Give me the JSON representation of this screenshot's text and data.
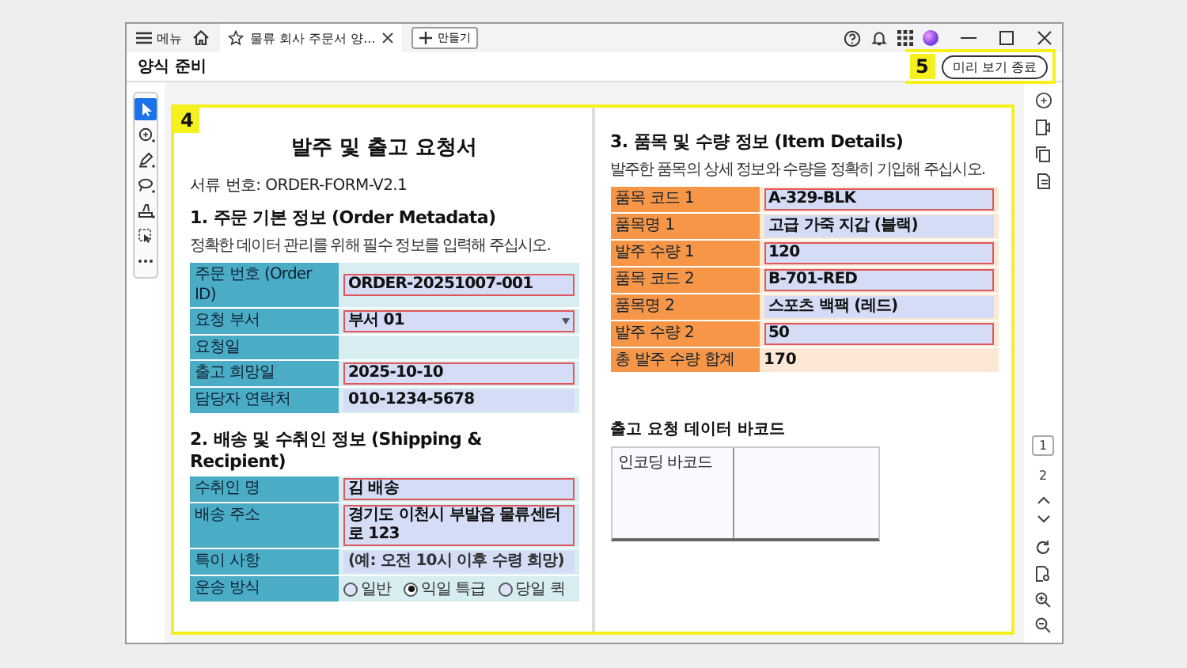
{
  "tabbar": {
    "menu": "메뉴",
    "tab": {
      "title": "물류 회사 주문서 양...",
      "selected": true
    },
    "new_tab": "만들기"
  },
  "toolbar_title": "양식 준비",
  "exit_preview": {
    "label": "미리 보기 종료",
    "annotation": "5"
  },
  "tools": [
    {
      "kind": "pointer",
      "selected": true
    },
    {
      "kind": "comment",
      "selected": false
    },
    {
      "kind": "pen",
      "selected": false
    },
    {
      "kind": "lasso",
      "selected": false
    },
    {
      "kind": "stamp",
      "selected": false
    },
    {
      "kind": "select",
      "selected": false
    },
    {
      "kind": "more",
      "selected": false
    }
  ],
  "document": {
    "annotation": "4",
    "pages": [
      {
        "title": "발주 및 출고 요청서",
        "doc_number": "서류 번호: ORDER-FORM-V2.1",
        "sections": [
          {
            "kind": "form",
            "heading": "1. 주문 기본 정보 (Order Metadata)",
            "description": "정확한 데이터 관리를 위해 필수 정보를 입력해 주십시오.",
            "color": "#4bacc6",
            "rows": [
              {
                "label": "주문 번호 (Order ID)",
                "kind": "input",
                "value": "ORDER-20251007-001",
                "required": true
              },
              {
                "label": "요청 부서",
                "kind": "select",
                "value": "부서 01",
                "required": true
              },
              {
                "label": "요청일",
                "kind": "blank"
              },
              {
                "label": "출고 희망일",
                "kind": "input",
                "value": "2025-10-10",
                "required": true
              },
              {
                "label": "담당자 연락처",
                "kind": "input",
                "value": "010-1234-5678",
                "required": false
              }
            ]
          },
          {
            "kind": "form",
            "heading": "2. 배송 및 수취인 정보 (Shipping & Recipient)",
            "color": "#4bacc6",
            "rows": [
              {
                "label": "수취인 명",
                "kind": "input",
                "value": "김 배송",
                "required": true
              },
              {
                "label": "배송 주소",
                "kind": "input",
                "value": "경기도 이천시 부발읍 물류센터로 123",
                "required": true
              },
              {
                "label": "특이 사항",
                "kind": "input",
                "placeholder": "(예: 오전 10시 이후 수령 희망)",
                "required": false
              },
              {
                "label": "운송 방식",
                "kind": "radio",
                "options": [
                  {
                    "label": "일반",
                    "selected": false
                  },
                  {
                    "label": "익일 특급",
                    "selected": true
                  },
                  {
                    "label": "당일 퀵",
                    "selected": false
                  }
                ]
              }
            ]
          }
        ]
      },
      {
        "sections": [
          {
            "kind": "form",
            "heading": "3. 품목 및 수량 정보 (Item Details)",
            "description": "발주한 품목의 상세 정보와 수량을 정확히 기입해 주십시오.",
            "color": "#f79646",
            "rows": [
              {
                "label": "품목 코드 1",
                "kind": "input",
                "value": "A-329-BLK",
                "required": true
              },
              {
                "label": "품목명 1",
                "kind": "input",
                "value": "고급 가죽 지갑 (블랙)",
                "required": false
              },
              {
                "label": "발주 수량 1",
                "kind": "input",
                "value": "120",
                "required": true
              },
              {
                "label": "품목 코드 2",
                "kind": "input",
                "value": "B-701-RED",
                "required": true
              },
              {
                "label": "품목명 2",
                "kind": "input",
                "value": "스포츠 백팩 (레드)",
                "required": false
              },
              {
                "label": "발주 수량 2",
                "kind": "input",
                "value": "50",
                "required": true
              },
              {
                "label": "총 발주 수량 합계",
                "kind": "text",
                "value": "170"
              }
            ]
          },
          {
            "kind": "barcode",
            "heading": "출고 요청 데이터 바코드",
            "cells": [
              "인코딩 바코드"
            ]
          }
        ]
      }
    ]
  },
  "page_nav": [
    {
      "label": "1",
      "selected": true
    },
    {
      "label": "2",
      "selected": false
    }
  ]
}
